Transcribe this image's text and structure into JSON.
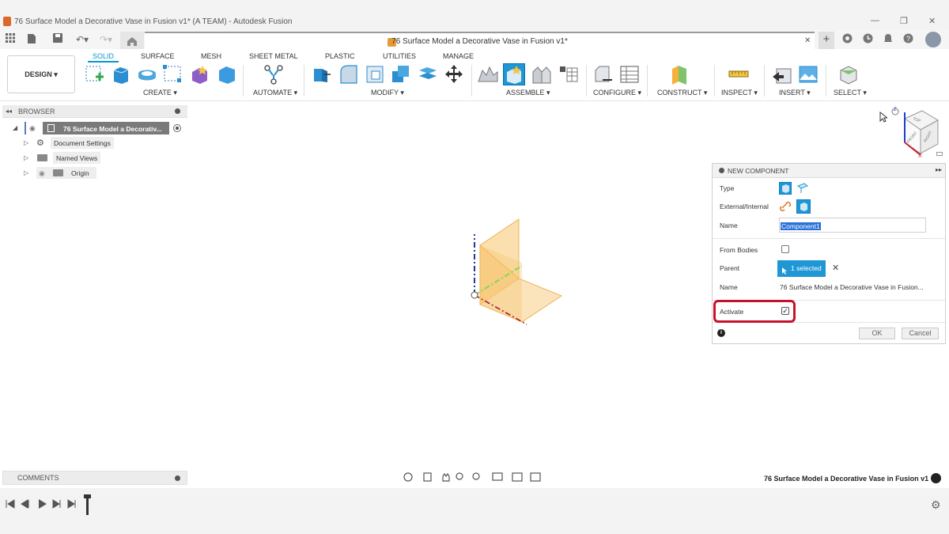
{
  "window": {
    "title": "76 Surface Model a Decorative Vase in Fusion v1* (A TEAM) - Autodesk Fusion",
    "minimize": "—",
    "restore": "❐",
    "close": "✕"
  },
  "tabbar": {
    "document_title": "76 Surface Model a Decorative Vase in Fusion v1*",
    "close": "✕",
    "add": "+"
  },
  "ribbon": {
    "workspace": "DESIGN ▾",
    "tabs": [
      "SOLID",
      "SURFACE",
      "MESH",
      "SHEET METAL",
      "PLASTIC",
      "UTILITIES",
      "MANAGE"
    ],
    "groups": {
      "create": "CREATE ▾",
      "automate": "AUTOMATE ▾",
      "modify": "MODIFY ▾",
      "assemble": "ASSEMBLE ▾",
      "configure": "CONFIGURE ▾",
      "construct": "CONSTRUCT ▾",
      "inspect": "INSPECT ▾",
      "insert": "INSERT ▾",
      "select": "SELECT ▾"
    }
  },
  "browser": {
    "title": "BROWSER",
    "root": "76 Surface Model a Decorativ...",
    "items": [
      "Document Settings",
      "Named Views",
      "Origin"
    ]
  },
  "comments": {
    "title": "COMMENTS"
  },
  "status": {
    "document_name": "76 Surface Model a Decorative Vase in Fusion v1"
  },
  "viewcube": {
    "top": "TOP",
    "front": "FRONT",
    "right": "RIGHT",
    "axis_x": "X",
    "axis_z": "Z"
  },
  "panel": {
    "title": "NEW COMPONENT",
    "type_label": "Type",
    "external_internal_label": "External/Internal",
    "name_label": "Name",
    "name_value": "Component1",
    "from_bodies_label": "From Bodies",
    "parent_label": "Parent",
    "parent_value": "1 selected",
    "parent_name_label": "Name",
    "parent_name_value": "76 Surface Model a Decorative Vase in Fusion...",
    "activate_label": "Activate",
    "activate_checked": true,
    "ok": "OK",
    "cancel": "Cancel"
  },
  "colors": {
    "accent": "#0696d7",
    "highlight": "#c5132b",
    "plane": "#f7c46b"
  }
}
